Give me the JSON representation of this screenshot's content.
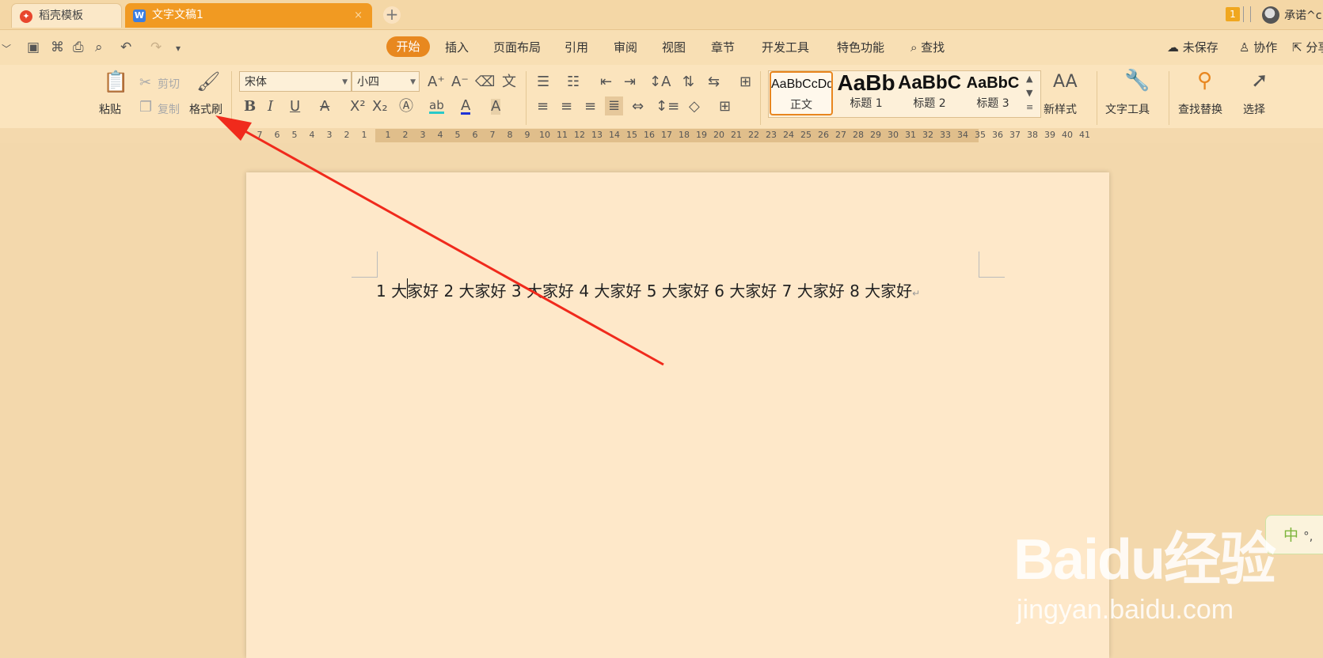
{
  "tabs": [
    {
      "label": "稻壳模板",
      "icon": "daoke-icon"
    },
    {
      "label": "文字文稿1",
      "icon": "wps-writer-icon",
      "close": "×"
    }
  ],
  "new_tab": "+",
  "top_right": {
    "badge": "1",
    "username": "承诺^c"
  },
  "menus": [
    "开始",
    "插入",
    "页面布局",
    "引用",
    "审阅",
    "视图",
    "章节",
    "开发工具",
    "特色功能",
    "查找"
  ],
  "right_actions": [
    "未保存",
    "协作",
    "分享"
  ],
  "ribbon": {
    "paste": "粘贴",
    "cut": "剪切",
    "copy": "复制",
    "format_painter": "格式刷",
    "font_name": "宋体",
    "font_size": "小四",
    "styles": [
      {
        "preview": "AaBbCcDd",
        "name": "正文"
      },
      {
        "preview": "AaBb",
        "name": "标题 1"
      },
      {
        "preview": "AaBbC",
        "name": "标题 2"
      },
      {
        "preview": "AaBbC",
        "name": "标题 3"
      }
    ],
    "new_style": "新样式",
    "text_tools": "文字工具",
    "find_replace": "查找替换",
    "select": "选择"
  },
  "ruler": {
    "left": [
      "7",
      "6",
      "5",
      "4",
      "3",
      "2",
      "1"
    ],
    "right": [
      "1",
      "2",
      "3",
      "4",
      "5",
      "6",
      "7",
      "8",
      "9",
      "10",
      "11",
      "12",
      "13",
      "14",
      "15",
      "16",
      "17",
      "18",
      "19",
      "20",
      "21",
      "22",
      "23",
      "24",
      "25",
      "26",
      "27",
      "28",
      "29",
      "30",
      "31",
      "32",
      "33",
      "34",
      "35",
      "36",
      "37",
      "38",
      "39",
      "40",
      "41"
    ]
  },
  "document": {
    "text": "1 大家好 2 大家好 3 大家好 4 大家好 5 大家好 6 大家好 7 大家好 8 大家好",
    "para_mark": "↵"
  },
  "ime": {
    "mode": "中",
    "punct": "°,"
  },
  "watermark": {
    "logo": "Baidu经验",
    "url": "jingyan.baidu.com"
  },
  "colors": {
    "accent": "#e8881f",
    "tab_active": "#f19a22",
    "arrow": "#f02a1c"
  }
}
